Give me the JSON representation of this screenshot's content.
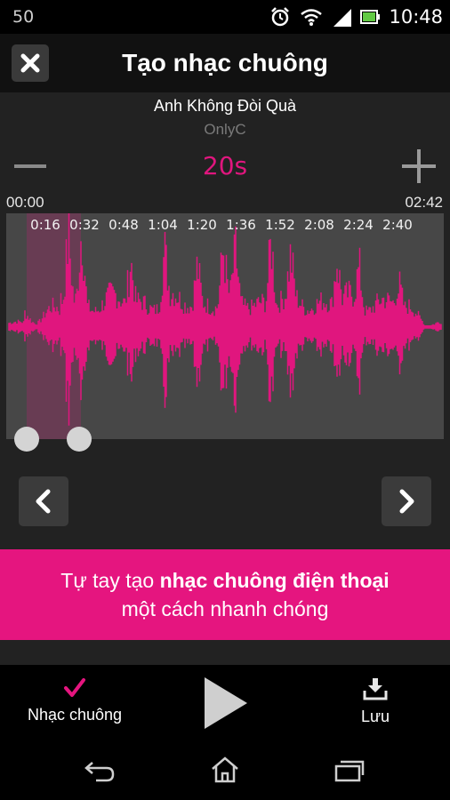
{
  "status_bar": {
    "left_indicator": "50",
    "time": "10:48",
    "icons": [
      "alarm-clock-icon",
      "wifi-icon",
      "signal-icon",
      "battery-icon"
    ]
  },
  "header": {
    "title": "Tạo nhạc chuông",
    "close_icon": "close-icon"
  },
  "song": {
    "title": "Anh Không Đòi Quà",
    "artist": "OnlyC"
  },
  "duration_control": {
    "value": "20s",
    "decrease_icon": "minus-icon",
    "increase_icon": "plus-icon"
  },
  "timeline": {
    "start": "00:00",
    "end": "02:42",
    "ticks": [
      "0:16",
      "0:32",
      "0:48",
      "1:04",
      "1:20",
      "1:36",
      "1:52",
      "2:08",
      "2:24",
      "2:40"
    ],
    "selection_start_seconds": 3,
    "selection_end_seconds": 23,
    "total_seconds": 162
  },
  "navigation": {
    "prev_icon": "chevron-left-icon",
    "next_icon": "chevron-right-icon"
  },
  "promo": {
    "line1_prefix": "Tự tay tạo ",
    "line1_bold": "nhạc chuông điện thoại",
    "line2": "một cách nhanh chóng"
  },
  "toolbar": {
    "ringtone_label": "Nhạc chuông",
    "save_label": "Lưu",
    "play_icon": "play-icon"
  },
  "system_nav": [
    "back-icon",
    "home-icon",
    "recent-apps-icon"
  ],
  "colors": {
    "accent": "#e5157f",
    "waveform": "#e0167e",
    "waveform_bg": "#474747",
    "header_bg": "#111111",
    "editor_bg": "#222222"
  }
}
